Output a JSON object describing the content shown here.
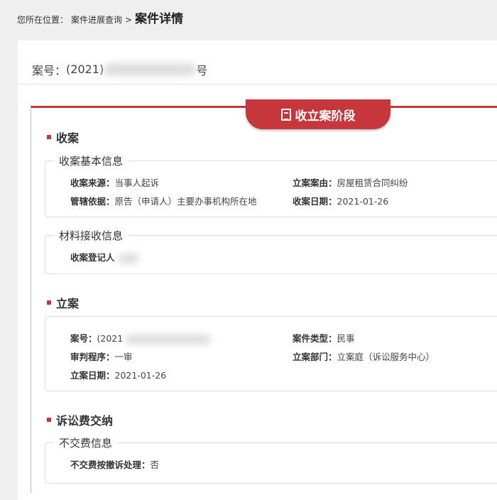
{
  "breadcrumb": {
    "prefix": "您所在位置：",
    "parent": "案件进展查询",
    "sep": ">",
    "current": "案件详情"
  },
  "case": {
    "label": "案号：",
    "prefix": "(2021)",
    "suffix": "号"
  },
  "stage": {
    "title": "收立案阶段"
  },
  "sections": {
    "receive": {
      "title": "收案",
      "basic": {
        "legend": "收案基本信息",
        "source_label": "收案来源：",
        "source": "当事人起诉",
        "cause_label": "立案案由：",
        "cause": "房屋租赁合同纠纷",
        "basis_label": "管辖依据：",
        "basis": "原告（申请人）主要办事机构所在地",
        "date_label": "收案日期：",
        "date": "2021-01-26"
      },
      "material": {
        "legend": "材料接收信息",
        "registrar_label": "收案登记人"
      }
    },
    "filing": {
      "title": "立案",
      "case_no_label": "案号：",
      "case_no_prefix": "(2021",
      "type_label": "案件类型：",
      "type": "民事",
      "procedure_label": "审判程序：",
      "procedure": "一审",
      "dept_label": "立案部门：",
      "dept": "立案庭（诉讼服务中心）",
      "date_label": "立案日期：",
      "date": "2021-01-26"
    },
    "fee": {
      "title": "诉讼费交纳",
      "legend": "不交费信息",
      "withdraw_label": "不交费按撤诉处理：",
      "withdraw": "否"
    }
  },
  "colors": {
    "accent": "#c6363a"
  }
}
